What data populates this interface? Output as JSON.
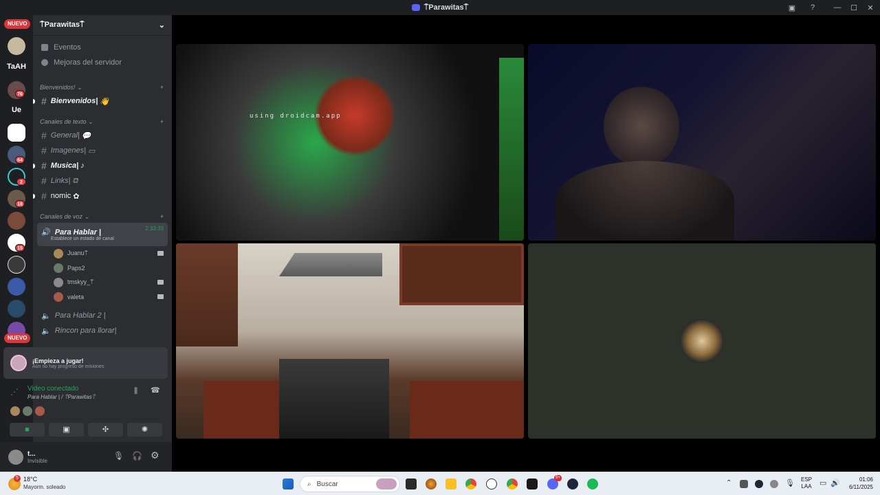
{
  "window": {
    "title": "⍑Parawitas⍑"
  },
  "rail": {
    "nuevo_top": "NUEVO",
    "nuevo_bottom": "NUEVO",
    "text_servers": [
      "TaAH",
      "Ue"
    ],
    "badges": [
      "76",
      "64",
      "2",
      "18",
      "15"
    ]
  },
  "guild": {
    "name": "⍑Parawitas⍑",
    "nav": [
      "Eventos",
      "Mejoras del servidor"
    ],
    "categories": {
      "welcome": "Bienvenidos!",
      "text": "Canales de texto",
      "voice": "Canales de voz"
    },
    "channels": {
      "welcome": "Bienvenidos|",
      "general": "General|",
      "imagenes": "Imagenes|",
      "musica": "Musica|",
      "links": "Links|",
      "nomic": "nomic"
    },
    "voice": {
      "active_name": "Para Hablar |",
      "active_timer": "2:33:33",
      "status_hint": "Establece un estado de canal",
      "users": [
        "Juanu⍑",
        "Paps2",
        "tmskyy_⍑",
        "valeta"
      ],
      "other1": "Para Hablar 2 |",
      "other2": "Rincon para llorar|"
    }
  },
  "quest": {
    "title": "¡Empieza a jugar!",
    "subtitle": "Aún no hay progreso de misiones"
  },
  "voice_connection": {
    "status": "Video conectado",
    "location": "Para Hablar | / ⍑Parawitas⍑"
  },
  "user": {
    "name": "t...",
    "status": "Invisible"
  },
  "video": {
    "watermark": "using droidcam.app"
  },
  "taskbar": {
    "weather_temp": "18°C",
    "weather_desc": "Mayorm. soleado",
    "weather_badge": "5",
    "search_placeholder": "Buscar",
    "lang_line1": "ESP",
    "lang_line2": "LAA",
    "time": "01:06",
    "date": "6/11/2025",
    "discord_badge": "9+"
  },
  "colors": {
    "accent": "#5865f2",
    "online": "#23a55a",
    "danger": "#da373c",
    "connected": "#23a55a"
  }
}
